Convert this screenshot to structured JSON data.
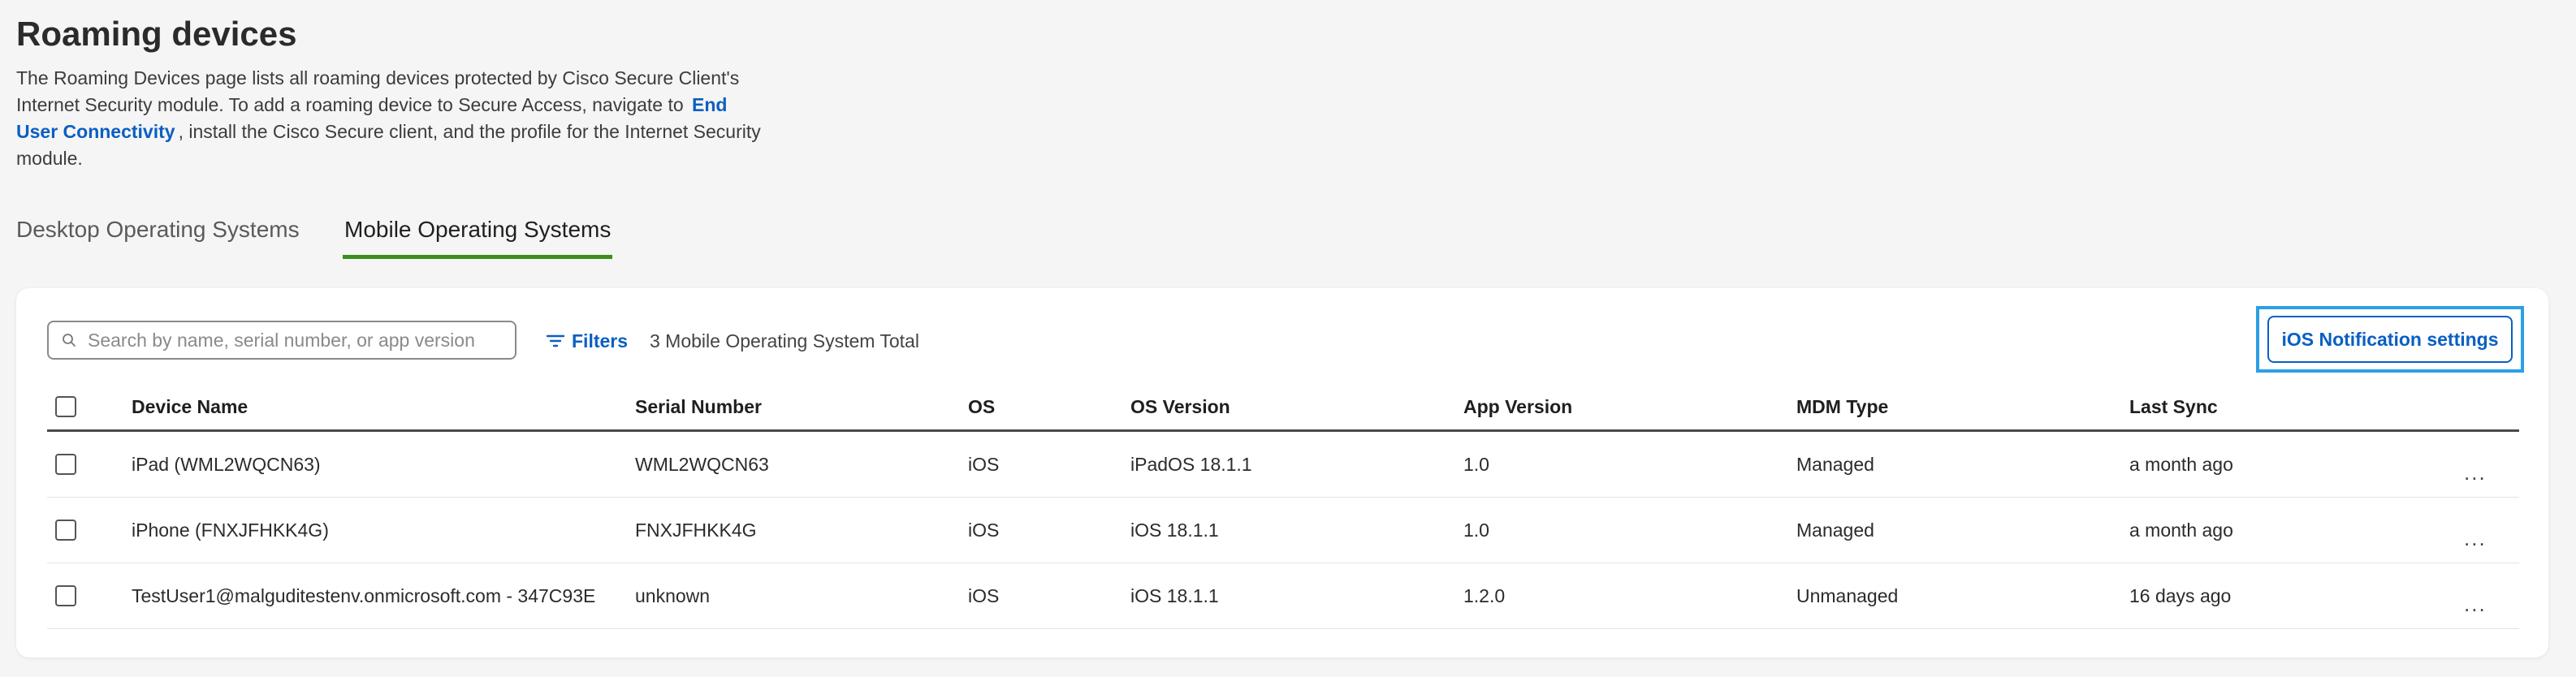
{
  "page": {
    "title": "Roaming devices",
    "desc_pre": "The Roaming Devices page lists all roaming devices protected by Cisco Secure Client's Internet Security module. To add a roaming device to Secure Access, navigate to",
    "desc_link": "End User Connectivity",
    "desc_post": ", install the Cisco Secure client, and the profile for the Internet Security module."
  },
  "tabs": {
    "desktop": "Desktop Operating Systems",
    "mobile": "Mobile Operating Systems"
  },
  "toolbar": {
    "search_placeholder": "Search by name, serial number, or app version",
    "filters_label": "Filters",
    "total_text": "3 Mobile Operating System Total",
    "ios_button": "iOS Notification settings"
  },
  "table": {
    "headers": {
      "device_name": "Device Name",
      "serial_number": "Serial Number",
      "os": "OS",
      "os_version": "OS Version",
      "app_version": "App Version",
      "mdm_type": "MDM Type",
      "last_sync": "Last Sync"
    },
    "rows": [
      {
        "device_name": "iPad (WML2WQCN63)",
        "serial_number": "WML2WQCN63",
        "os": "iOS",
        "os_version": "iPadOS 18.1.1",
        "app_version": "1.0",
        "mdm_type": "Managed",
        "last_sync": "a month ago",
        "actions": "..."
      },
      {
        "device_name": "iPhone (FNXJFHKK4G)",
        "serial_number": "FNXJFHKK4G",
        "os": "iOS",
        "os_version": "iOS 18.1.1",
        "app_version": "1.0",
        "mdm_type": "Managed",
        "last_sync": "a month ago",
        "actions": "..."
      },
      {
        "device_name": "TestUser1@malguditestenv.onmicrosoft.com - 347C93E",
        "serial_number": "unknown",
        "os": "iOS",
        "os_version": "iOS 18.1.1",
        "app_version": "1.2.0",
        "mdm_type": "Unmanaged",
        "last_sync": "16 days ago",
        "actions": "..."
      }
    ]
  },
  "colors": {
    "accent": "#0a5fc2",
    "active_tab_underline": "#3b8f1c",
    "highlight_border": "#2aa0e6"
  },
  "icons": [
    "search-icon",
    "filter-icon",
    "more-actions-icon"
  ]
}
